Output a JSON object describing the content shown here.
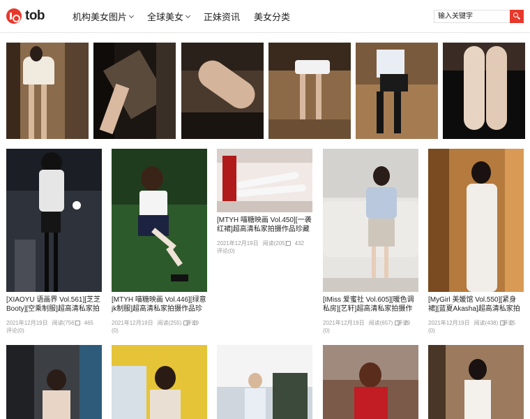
{
  "header": {
    "logo_text": "tob",
    "nav": [
      {
        "label": "机构美女图片",
        "has_dropdown": true
      },
      {
        "label": "全球美女",
        "has_dropdown": true
      },
      {
        "label": "正妹资讯",
        "has_dropdown": false
      },
      {
        "label": "美女分类",
        "has_dropdown": false
      }
    ],
    "search_placeholder": "输入关键字"
  },
  "cards": [
    {
      "title": "[XIAOYU 语画界 Vol.561][芝芝Booty][空乘制服]超高清私家拍摄",
      "date": "2021年12月19日",
      "views": "阅读(756)",
      "comments": "评论(0)",
      "likes": "465"
    },
    {
      "title": "[MTYH 喵糖映画 Vol.446][绿意jk制服]超高清私家拍摄作品珍藏版",
      "date": "2021年12月19日",
      "views": "阅读(255)",
      "comments": "评论(0)",
      "likes": "19"
    },
    {
      "title": "[MTYH 喵糖映画 Vol.450][一袭红裙]超高清私家拍摄作品珍藏版",
      "date": "2021年12月19日",
      "views": "阅读(205)",
      "comments": "评论(0)",
      "likes": "432"
    },
    {
      "title": "[IMiss 爱蜜社 Vol.605][暖色调私房][艺轩]超高清私家拍摄作品珍藏",
      "date": "2021年12月19日",
      "views": "阅读(657)",
      "comments": "评论(0)",
      "likes": "29"
    },
    {
      "title": "[MyGirl 美媛馆 Vol.550][紧身裙][蓝夏Akasha]超高清私家拍摄作品",
      "date": "2021年12月19日",
      "views": "阅读(438)",
      "comments": "评论(0)",
      "likes": "15"
    }
  ]
}
